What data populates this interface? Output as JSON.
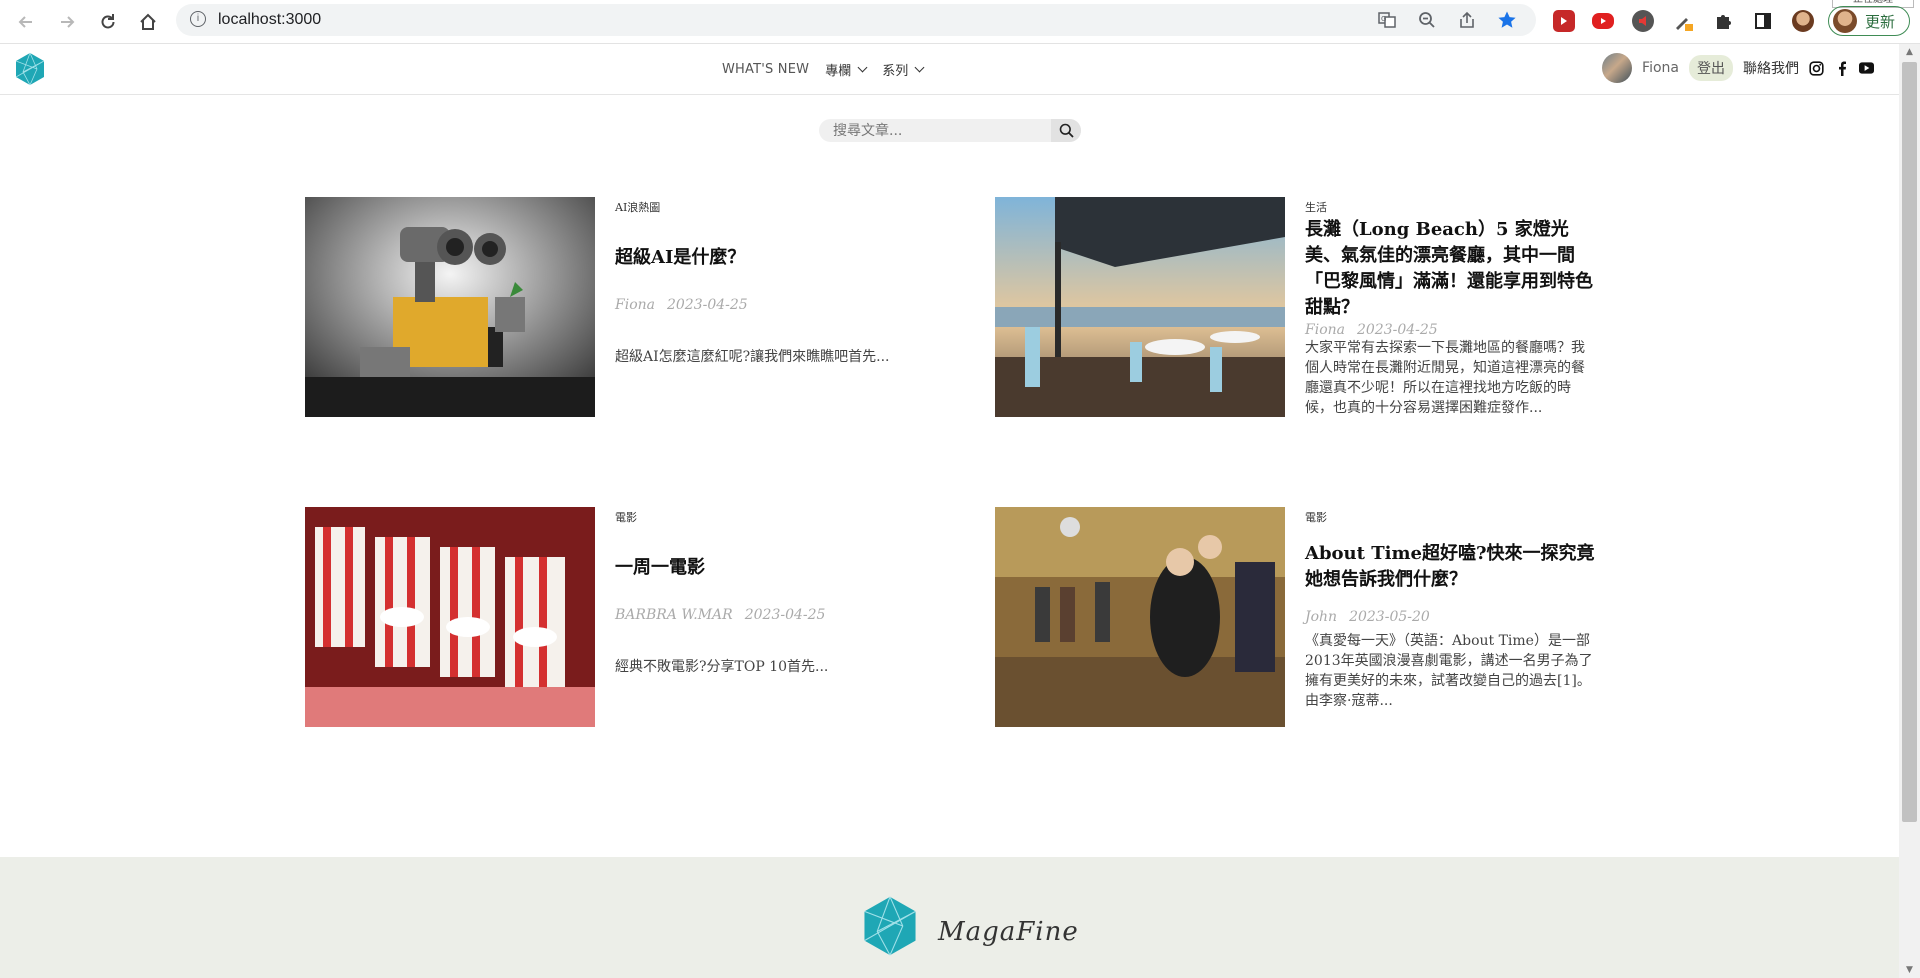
{
  "browser": {
    "url": "localhost:3000",
    "update_label": "更新",
    "tooltip": "正在處理"
  },
  "site": {
    "nav": {
      "whats_new": "WHAT'S NEW",
      "columns": "專欄",
      "series": "系列"
    },
    "user": {
      "name": "Fiona",
      "logout": "登出",
      "contact": "聯絡我們"
    },
    "search": {
      "placeholder": "搜尋文章..."
    },
    "footer": {
      "brand": "MagaFine"
    },
    "colors": {
      "brand_teal": "#1fa7b5",
      "logout_bg": "#e6ecd9",
      "footer_bg": "#eceee8"
    }
  },
  "articles": [
    {
      "category": "AI浪熱圖",
      "title": "超級AI是什麼？",
      "author": "Fiona",
      "date": "2023-04-25",
      "excerpt": "超級AI怎麼這麼紅呢?讓我們來瞧瞧吧首先..."
    },
    {
      "category": "生活",
      "title": "長灘（Long Beach）5 家燈光美、氣氛佳的漂亮餐廳，其中一間「巴黎風情」滿滿！還能享用到特色甜點？",
      "author": "Fiona",
      "date": "2023-04-25",
      "excerpt": "大家平常有去探索一下長灘地區的餐廳嗎？我個人時常在長灘附近閒晃，知道這裡漂亮的餐廳還真不少呢！所以在這裡找地方吃飯的時候，也真的十分容易選擇困難症發作..."
    },
    {
      "category": "電影",
      "title": "一周一電影",
      "author": "BARBRA W.MAR",
      "date": "2023-04-25",
      "excerpt": "經典不敗電影?分享TOP 10首先..."
    },
    {
      "category": "電影",
      "title": "About Time超好嗑?快來一探究竟她想告訴我們什麼？",
      "author": "John",
      "date": "2023-05-20",
      "excerpt": "《真愛每一天》（英語：About Time）是一部2013年英國浪漫喜劇電影，講述一名男子為了擁有更美好的未來，試著改變自己的過去[1]。由李察·寇蒂..."
    }
  ]
}
